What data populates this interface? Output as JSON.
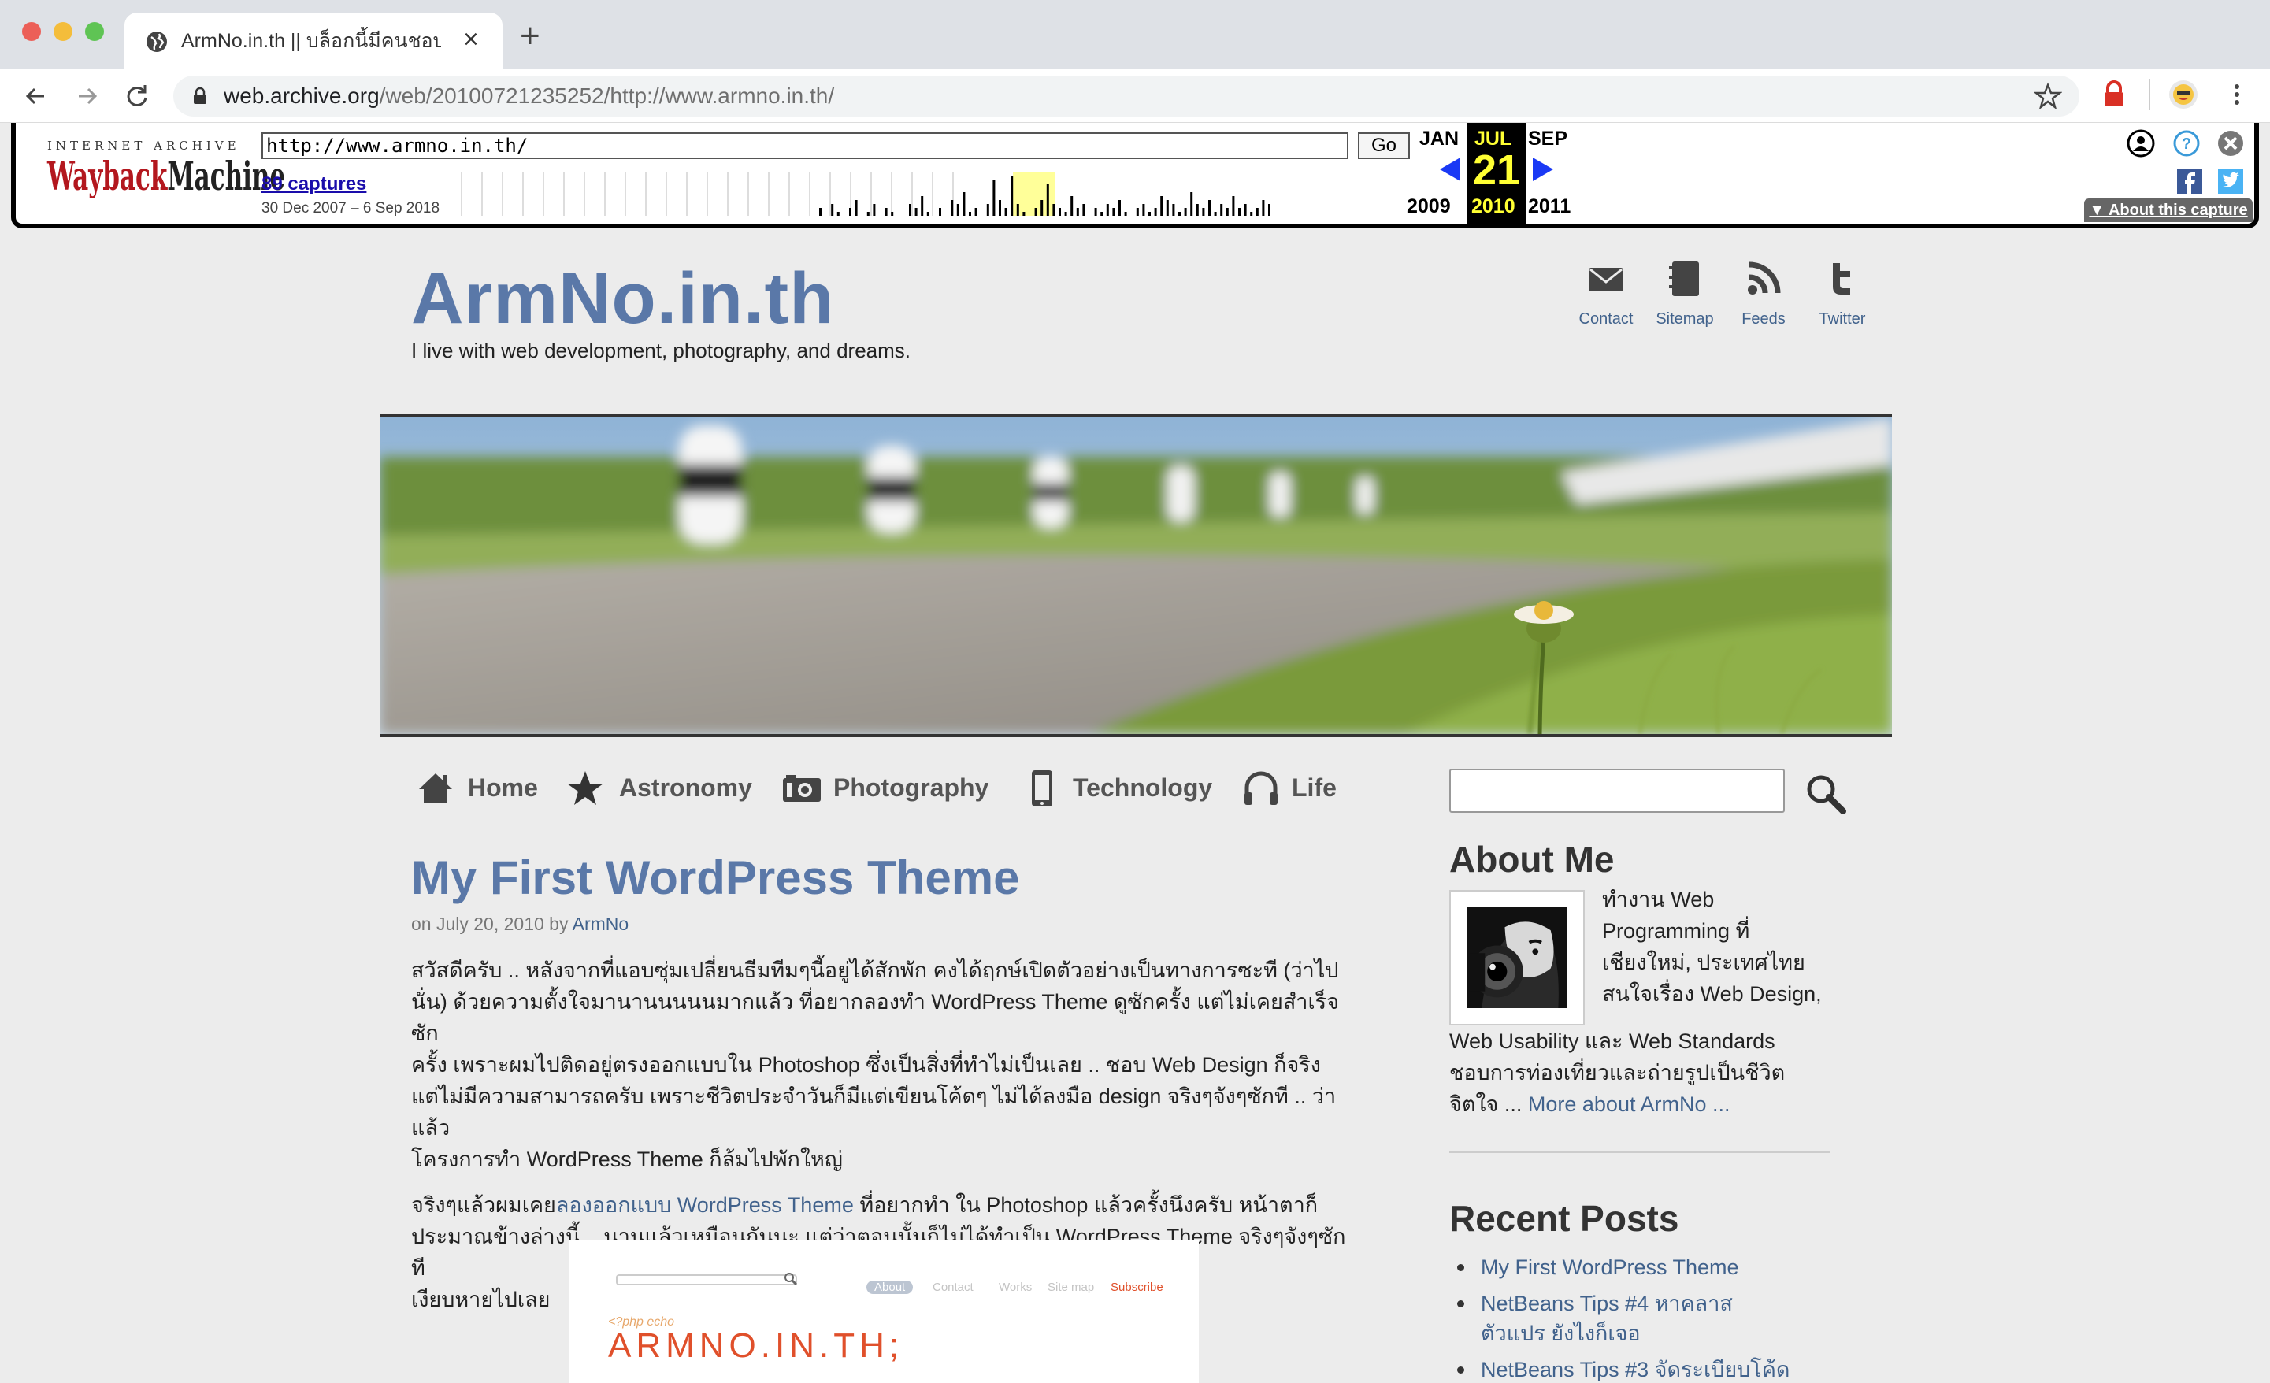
{
  "browser": {
    "tab_title": "ArmNo.in.th || บล็อกนี้มีคนชอบดู",
    "url_domain": "web.archive.org",
    "url_path": "/web/20100721235252/http://www.armno.in.th/"
  },
  "wayback": {
    "logo_top": "INTERNET ARCHIVE",
    "logo_a": "Wayback",
    "logo_b": "Machine",
    "url_value": "http://www.armno.in.th/",
    "go_label": "Go",
    "captures_label": "89 captures",
    "date_range": "30 Dec 2007 – 6 Sep 2018",
    "prev_month": "JAN",
    "cur_month": "JUL",
    "next_month": "SEP",
    "cur_day": "21",
    "prev_year": "2009",
    "cur_year": "2010",
    "next_year": "2011",
    "about_label": "▼ About this capture",
    "spark_bars": [
      2,
      0,
      3,
      1,
      0,
      2,
      4,
      0,
      1,
      3,
      0,
      2,
      1,
      0,
      0,
      3,
      2,
      5,
      1,
      0,
      2,
      0,
      4,
      3,
      6,
      1,
      2,
      0,
      3,
      9,
      4,
      2,
      10,
      3,
      1,
      0,
      2,
      4,
      8,
      3,
      2,
      1,
      5,
      2,
      3,
      0,
      2,
      1,
      3,
      2,
      4,
      1,
      0,
      2,
      3,
      1,
      2,
      5,
      4,
      3,
      1,
      2,
      6,
      3,
      2,
      4,
      1,
      3,
      2,
      5,
      2,
      3,
      1,
      2,
      4,
      3
    ],
    "highlight_color": "#ffff99"
  },
  "site": {
    "title": "ArmNo.in.th",
    "tagline": "I live with web development, photography, and dreams.",
    "top_links": [
      {
        "label": "Contact",
        "icon": "envelope-icon"
      },
      {
        "label": "Sitemap",
        "icon": "notebook-icon"
      },
      {
        "label": "Feeds",
        "icon": "rss-icon"
      },
      {
        "label": "Twitter",
        "icon": "twitter-icon"
      }
    ],
    "nav": [
      {
        "label": "Home",
        "icon": "house-icon"
      },
      {
        "label": "Astronomy",
        "icon": "star-icon"
      },
      {
        "label": "Photography",
        "icon": "camera-icon"
      },
      {
        "label": "Technology",
        "icon": "phone-icon"
      },
      {
        "label": "Life",
        "icon": "headphones-icon"
      }
    ]
  },
  "post": {
    "title": "My First WordPress Theme",
    "meta_prefix": "on July 20, 2010 by",
    "author": "ArmNo",
    "para1_lines": [
      "สวัสดีครับ .. หลังจากที่แอบซุ่มเปลี่ยนธีมทีมๆนี้อยู่ได้สักพัก คงได้ฤกษ์เปิดตัวอย่างเป็นทางการซะที (ว่าไป",
      "นั่น) ด้วยความตั้งใจมานานนนนนมากแล้ว ที่อยากลองทำ WordPress Theme ดูซักครั้ง แต่ไม่เคยสำเร็จซัก",
      "ครั้ง เพราะผมไปติดอยู่ตรงออกแบบใน Photoshop ซึ่งเป็นสิ่งที่ทำไม่เป็นเลย .. ชอบ Web Design ก็จริง",
      "แต่ไม่มีความสามารถครับ เพราะชีวิตประจำวันก็มีแต่เขียนโค้ดๆ ไม่ได้ลงมือ design จริงๆจังๆซักที .. ว่าแล้ว",
      "โครงการทำ WordPress Theme ก็ล้มไปพักใหญ่"
    ],
    "para2_pre": "จริงๆแล้วผมเคย",
    "para2_link": "ลองออกแบบ WordPress Theme",
    "para2_post": " ที่อยากทำ ใน Photoshop แล้วครั้งนึงครับ หน้าตาก็",
    "para2_lines": [
      "ประมาณข้างล่างนี้ .. นานแล้วเหมือนกันนะ แต่ว่าตอนนั้นก็ไม่ได้ทำเป็น WordPress Theme จริงๆจังๆซักที",
      "เงียบหายไปเลย"
    ],
    "shot_tabs": [
      "About",
      "Contact",
      "Works",
      "Site map",
      "Subscribe"
    ],
    "shot_php": "<?php echo",
    "shot_logo": "ARMNO.IN.TH;"
  },
  "sidebar": {
    "about_heading": "About Me",
    "about_lines_right": [
      "ทำงาน Web",
      "Programming ที่",
      "เชียงใหม่, ประเทศไทย",
      "สนใจเรื่อง Web Design,"
    ],
    "about_lines_full": [
      "Web Usability และ Web Standards",
      "ชอบการท่องเที่ยวและถ่ายรูปเป็นชีวิต"
    ],
    "about_last_pre": "จิตใจ ... ",
    "about_more": "More about ArmNo ...",
    "recent_heading": "Recent Posts",
    "recent": [
      "My First WordPress Theme",
      "NetBeans Tips #4 หาคลาส ตัวแปร ยังไงก็เจอ",
      "NetBeans Tips #3 จัดระเบียบโค้ด"
    ]
  }
}
